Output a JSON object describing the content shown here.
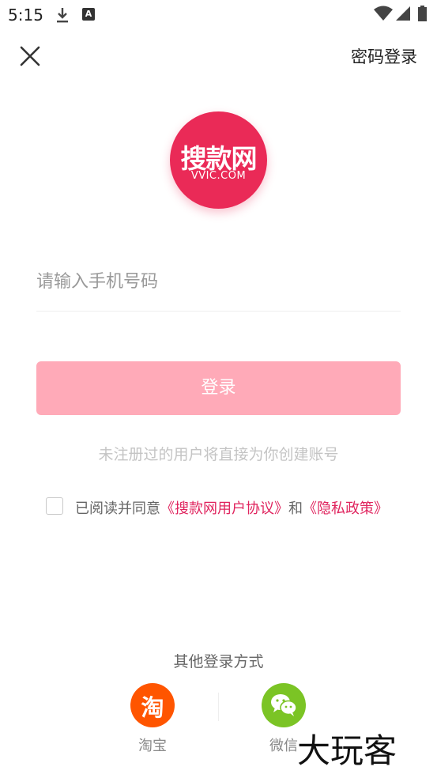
{
  "status_bar": {
    "time": "5:15",
    "notification_icons": [
      "download-icon",
      "a-icon"
    ],
    "a_icon_glyph": "A",
    "system_icons": [
      "wifi-icon",
      "signal-icon",
      "battery-icon"
    ]
  },
  "top_bar": {
    "close_icon": "close-icon",
    "password_login_label": "密码登录"
  },
  "logo": {
    "brand_cn": "搜款网",
    "brand_en": "VVIC.COM",
    "color": "#ea2a57"
  },
  "form": {
    "phone_placeholder": "请输入手机号码",
    "phone_value": "",
    "login_button_label": "登录",
    "button_color": "#ffaab8",
    "hint": "未注册过的用户将直接为你创建账号"
  },
  "agreement": {
    "checked": false,
    "prefix": "已阅读并同意",
    "user_agreement": "《搜款网用户协议》",
    "conjunction": "和",
    "privacy_policy": "《隐私政策》",
    "link_color": "#e0245e"
  },
  "other_login": {
    "title": "其他登录方式",
    "options": [
      {
        "label": "淘宝",
        "glyph": "淘",
        "icon": "taobao-icon",
        "color": "#ff5500"
      },
      {
        "label": "微信",
        "icon": "wechat-icon",
        "color": "#7bc425"
      }
    ]
  },
  "watermark": "大玩客"
}
